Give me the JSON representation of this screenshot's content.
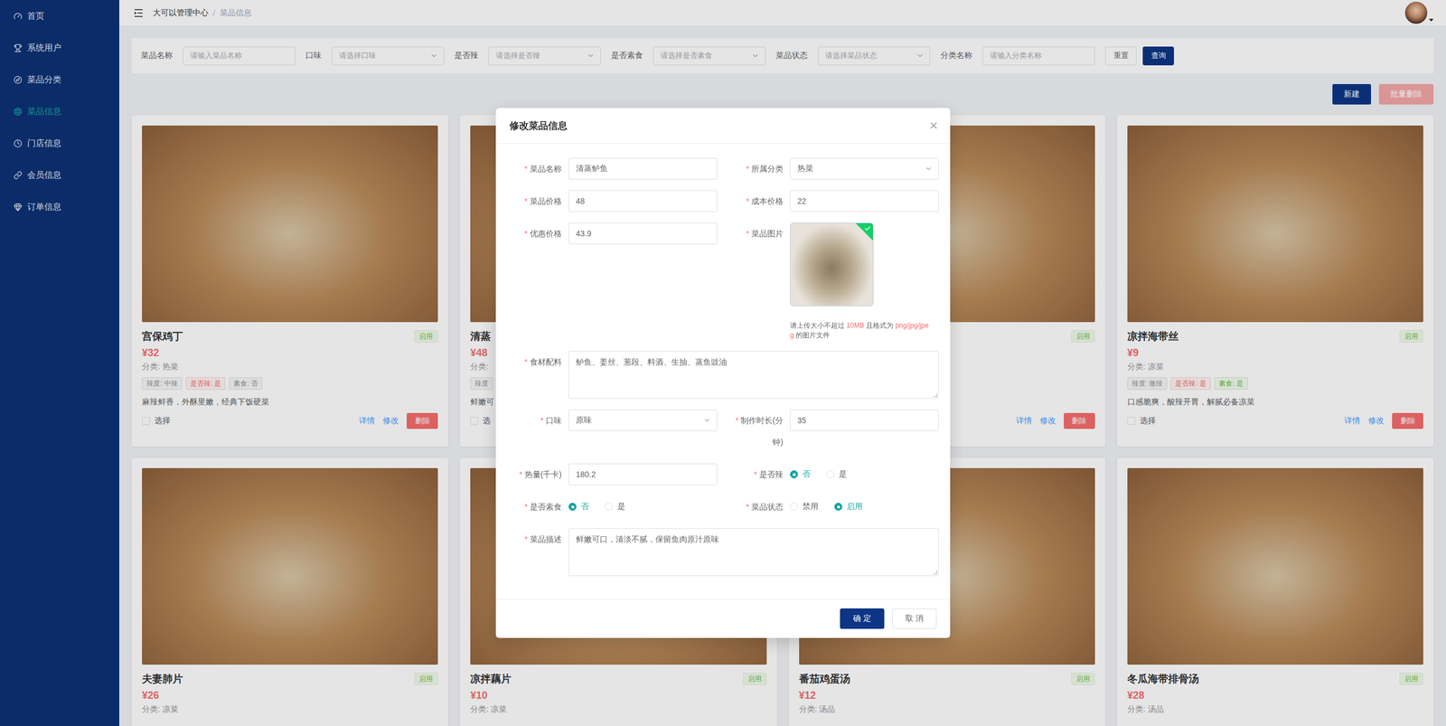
{
  "sidebar": {
    "items": [
      {
        "label": "首页",
        "selected": false
      },
      {
        "label": "系统用户",
        "selected": false
      },
      {
        "label": "菜品分类",
        "selected": false
      },
      {
        "label": "菜品信息",
        "selected": true
      },
      {
        "label": "门店信息",
        "selected": false
      },
      {
        "label": "会员信息",
        "selected": false
      },
      {
        "label": "订单信息",
        "selected": false
      }
    ]
  },
  "header": {
    "breadcrumb": [
      {
        "label": "大可以管理中心",
        "current": false
      },
      {
        "label": "菜品信息",
        "current": true
      }
    ],
    "separator": "/"
  },
  "filters": {
    "fields": [
      {
        "label": "菜品名称",
        "placeholder": "请输入菜品名称",
        "kind": "input"
      },
      {
        "label": "口味",
        "placeholder": "请选择口味",
        "kind": "select"
      },
      {
        "label": "是否辣",
        "placeholder": "请选择是否辣",
        "kind": "select"
      },
      {
        "label": "是否素食",
        "placeholder": "请选择是否素食",
        "kind": "select"
      },
      {
        "label": "菜品状态",
        "placeholder": "请选择菜品状态",
        "kind": "select"
      },
      {
        "label": "分类名称",
        "placeholder": "请输入分类名称",
        "kind": "input"
      }
    ],
    "buttons": [
      {
        "label": "重置",
        "primary": false
      },
      {
        "label": "查询",
        "primary": true
      }
    ]
  },
  "actions": [
    {
      "label": "新建",
      "disabled": false
    },
    {
      "label": "批量删除",
      "disabled": true
    }
  ],
  "cards": [
    {
      "title": "宫保鸡丁",
      "price": "¥32",
      "category": "分类: 热菜",
      "status": "启用",
      "tags": [
        {
          "text": "辣度: 中辣",
          "color": "#909399"
        },
        {
          "text": "是否辣: 是",
          "color": "#f56c6c"
        },
        {
          "text": "素食: 否",
          "color": "#909399"
        }
      ],
      "description": "麻辣鲜香，外酥里嫩，经典下饭硬菜",
      "select": "选择",
      "buttons": [
        {
          "label": "详情",
          "kind": "link"
        },
        {
          "label": "修改",
          "kind": "link"
        },
        {
          "label": "删除",
          "kind": "danger"
        }
      ]
    },
    {
      "title": "清蒸",
      "price": "¥48",
      "category": "分类:",
      "tags": [
        {
          "text": "辣度",
          "color": "#909399"
        }
      ],
      "description": "鲜嫩可",
      "select": "选"
    },
    {
      "status": "启用",
      "buttons": [
        {
          "label": "详情",
          "kind": "link"
        },
        {
          "label": "修改",
          "kind": "link"
        },
        {
          "label": "删除",
          "kind": "danger"
        }
      ]
    },
    {
      "title": "凉拌海带丝",
      "price": "¥9",
      "category": "分类: 凉菜",
      "status": "启用",
      "tags": [
        {
          "text": "辣度: 微辣",
          "color": "#909399"
        },
        {
          "text": "是否辣: 是",
          "color": "#f56c6c"
        },
        {
          "text": "素食: 是",
          "color": "#67c23a"
        }
      ],
      "description": "口感脆爽，酸辣开胃，解腻必备凉菜",
      "select": "选择",
      "buttons": [
        {
          "label": "详情",
          "kind": "link"
        },
        {
          "label": "修改",
          "kind": "link"
        },
        {
          "label": "删除",
          "kind": "danger"
        }
      ]
    },
    {
      "title": "夫妻肺片",
      "price": "¥26",
      "category": "分类: 凉菜",
      "status": "启用"
    },
    {
      "title": "凉拌藕片",
      "price": "¥10",
      "category": "分类: 凉菜",
      "status": "启用"
    },
    {
      "title": "番茄鸡蛋汤",
      "price": "¥12",
      "category": "分类: 汤品",
      "status": "启用"
    },
    {
      "title": "冬瓜海带排骨汤",
      "price": "¥28",
      "category": "分类: 汤品",
      "status": "启用"
    }
  ],
  "modal": {
    "title": "修改菜品信息",
    "required_mark": "*",
    "fields": [
      {
        "label": "菜品名称",
        "kind": "input",
        "value": "清蒸鲈鱼",
        "required": true
      },
      {
        "label": "所属分类",
        "kind": "select",
        "value": "热菜",
        "required": true
      },
      {
        "label": "菜品价格",
        "kind": "input",
        "value": "48",
        "required": true
      },
      {
        "label": "成本价格",
        "kind": "input",
        "value": "22",
        "required": true
      },
      {
        "label": "优惠价格",
        "kind": "input",
        "value": "43.9",
        "required": true
      },
      {
        "label": "菜品图片",
        "kind": "upload",
        "uploaded": true,
        "required": true,
        "hint": [
          {
            "text": "请上传大小不超过 ",
            "highlight": false
          },
          {
            "text": "10MB",
            "highlight": true
          },
          {
            "text": " 且格式为 ",
            "highlight": false
          },
          {
            "text": "png/jpg/jpeg",
            "highlight": true
          },
          {
            "text": " 的图片文件",
            "highlight": false
          }
        ]
      },
      {
        "label": "食材配料",
        "kind": "textarea",
        "value": "鲈鱼、姜丝、葱段、料酒、生抽、蒸鱼豉油",
        "required": true
      },
      {
        "label": "口味",
        "kind": "select",
        "value": "原味",
        "required": true
      },
      {
        "label": "制作时长(分钟)",
        "kind": "input",
        "value": "35",
        "required": true
      },
      {
        "label": "热量(千卡)",
        "kind": "input",
        "value": "180.2",
        "required": true
      },
      {
        "label": "是否辣",
        "kind": "radio",
        "required": true,
        "options": [
          {
            "label": "否",
            "selected": true
          },
          {
            "label": "是",
            "selected": false
          }
        ]
      },
      {
        "label": "是否素食",
        "kind": "radio",
        "required": true,
        "options": [
          {
            "label": "否",
            "selected": true
          },
          {
            "label": "是",
            "selected": false
          }
        ]
      },
      {
        "label": "菜品状态",
        "kind": "radio",
        "required": true,
        "options": [
          {
            "label": "禁用",
            "selected": false
          },
          {
            "label": "启用",
            "selected": true
          }
        ]
      },
      {
        "label": "菜品描述",
        "kind": "textarea",
        "value": "鲜嫩可口，清淡不腻，保留鱼肉原汁原味",
        "required": true
      }
    ],
    "buttons": [
      {
        "label": "确 定",
        "primary": true
      },
      {
        "label": "取 消",
        "primary": false
      }
    ]
  }
}
